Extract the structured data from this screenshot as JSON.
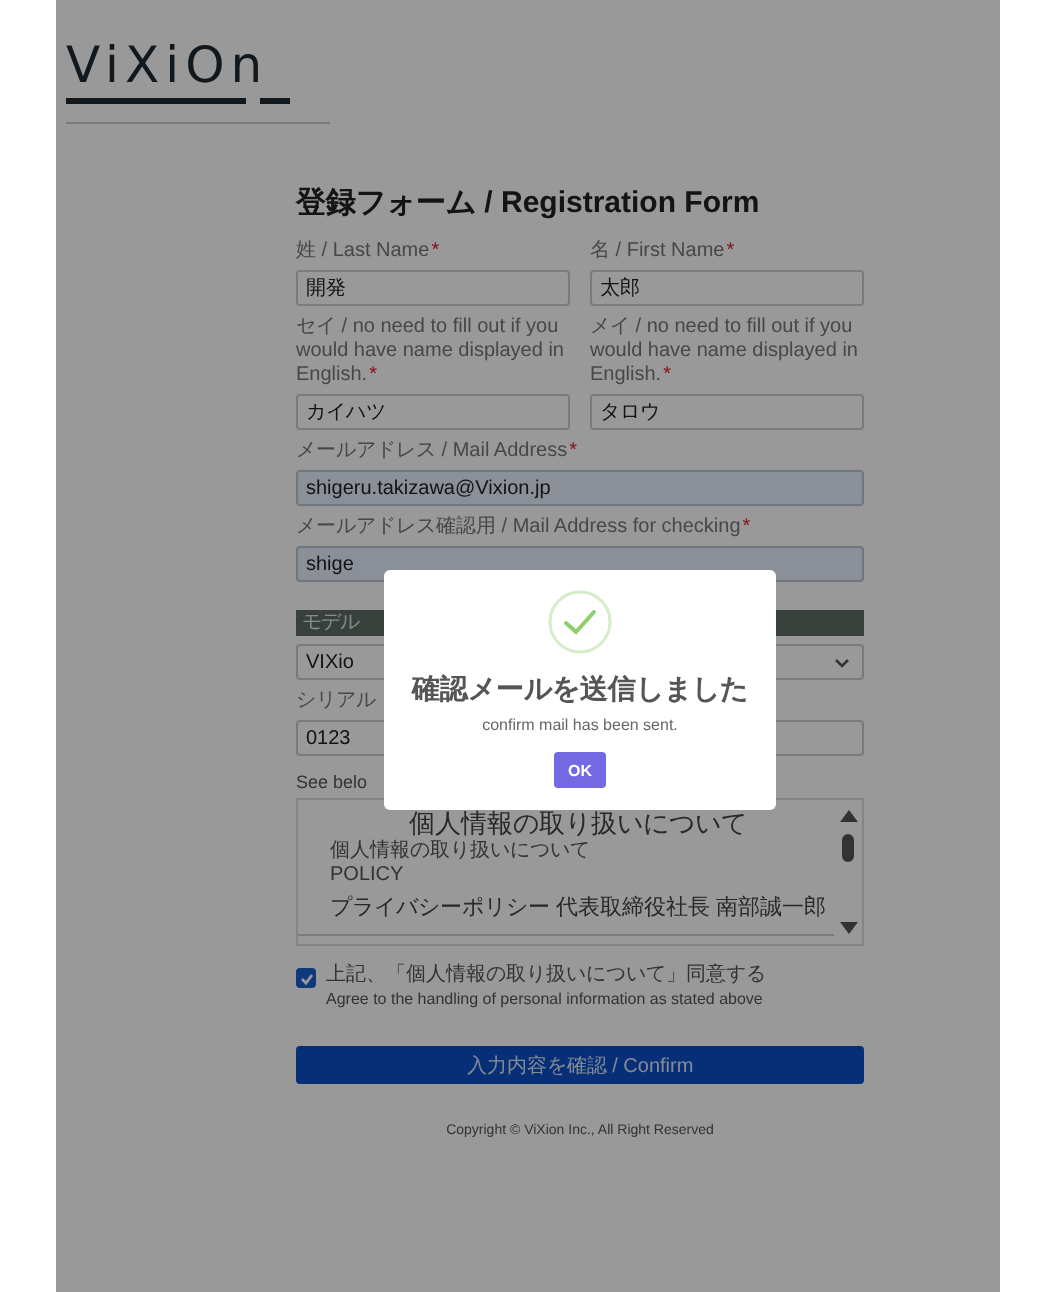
{
  "logo": {
    "text": "ViXiOn"
  },
  "form": {
    "title": "登録フォーム / Registration Form",
    "rows": [
      {
        "kind": "pair",
        "fields": [
          {
            "label": "姓 / Last Name",
            "required_mark": "*",
            "value": "開発",
            "autofilled": false
          },
          {
            "label": "名 / First Name",
            "required_mark": "*",
            "value": "太郎",
            "autofilled": false
          }
        ]
      },
      {
        "kind": "pair",
        "fields": [
          {
            "label": "セイ / no need to fill out if you would have name displayed in English.",
            "required_mark": "*",
            "value": "カイハツ",
            "autofilled": false
          },
          {
            "label": "メイ / no need to fill out if you would have name displayed in English.",
            "required_mark": "*",
            "value": "タロウ",
            "autofilled": false
          }
        ]
      },
      {
        "kind": "text",
        "label": "メールアドレス / Mail Address",
        "required_mark": "*",
        "value": "shigeru.takizawa@Vixion.jp",
        "autofilled": true
      },
      {
        "kind": "text",
        "label": "メールアドレス確認用 / Mail Address for checking",
        "required_mark": "*",
        "value": "shige",
        "autofilled": true
      },
      {
        "kind": "section",
        "label": "モデル"
      },
      {
        "kind": "select",
        "value": "VIXio"
      },
      {
        "kind": "text",
        "label": "シリアル",
        "value": "0123",
        "autofilled": false
      }
    ]
  },
  "policy": {
    "intro": "See belo",
    "heading": "個人情報の取り扱いについて",
    "lines": [
      "個人情報の取り扱いについて",
      "POLICY"
    ],
    "subheading": "プライバシーポリシー 代表取締役社長 南部誠一郎"
  },
  "agreement": {
    "checked": true,
    "label": "上記、「個人情報の取り扱いについて」同意する",
    "note": "Agree to the handling of personal information as stated above"
  },
  "confirm_button": "入力内容を確認 / Confirm",
  "copyright": "Copyright © ViXion Inc., All Right Reserved",
  "dialog": {
    "title": "確認メールを送信しました",
    "message": "confirm mail has been sent.",
    "button": "OK"
  }
}
